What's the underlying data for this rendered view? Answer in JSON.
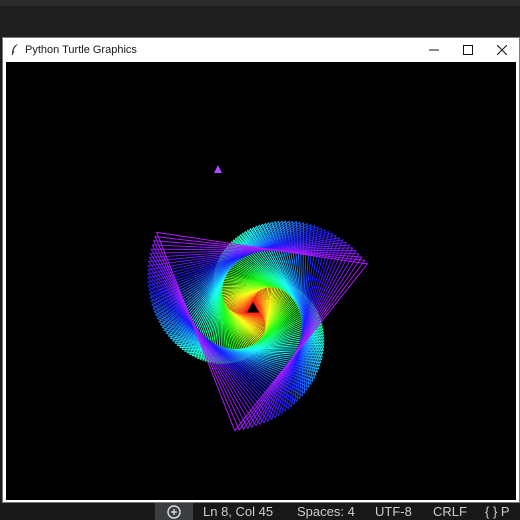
{
  "window": {
    "title": "Python Turtle Graphics",
    "controls": [
      "minimize",
      "maximize",
      "close"
    ]
  },
  "app_icon": "feather-icon",
  "canvas": {
    "background": "#000000",
    "drawing": "rainbow spiral of rotating triangles",
    "palette": [
      "#ff2a00",
      "#ff8c00",
      "#ffee00",
      "#5aff00",
      "#00ff9a",
      "#00e0ff",
      "#2a7bff",
      "#5a3cff",
      "#9b3cff"
    ]
  },
  "statusbar": {
    "zoom_icon": "zoom-in-icon",
    "position": "Ln 8, Col 45",
    "indent": "Spaces: 4",
    "encoding": "UTF-8",
    "eol": "CRLF",
    "language": "{ } P"
  }
}
